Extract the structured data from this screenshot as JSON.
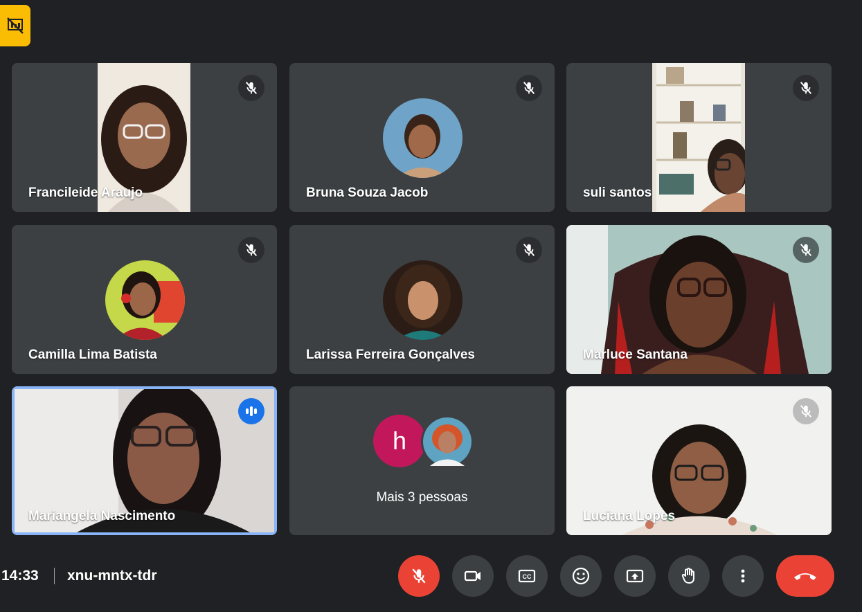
{
  "participants": [
    {
      "name": "Francileide Araujo",
      "mic": "muted",
      "view": "video"
    },
    {
      "name": "Bruna Souza Jacob",
      "mic": "muted",
      "view": "avatar"
    },
    {
      "name": "suli santos",
      "mic": "muted",
      "view": "video"
    },
    {
      "name": "Camilla Lima Batista",
      "mic": "muted",
      "view": "avatar"
    },
    {
      "name": "Larissa Ferreira Gonçalves",
      "mic": "muted",
      "view": "avatar"
    },
    {
      "name": "Marluce Santana",
      "mic": "muted",
      "view": "video"
    },
    {
      "name": "Mariangela Nascimento",
      "mic": "speaking",
      "view": "video"
    },
    {
      "name": "Luciana Lopes",
      "mic": "muted",
      "view": "video"
    }
  ],
  "overflow": {
    "initial": "h",
    "label": "Mais 3 pessoas"
  },
  "footer": {
    "time": "14:33",
    "meeting_code": "xnu-mntx-tdr"
  },
  "controls": [
    {
      "name": "mic-off-button",
      "icon": "mic-off-icon",
      "state": "off"
    },
    {
      "name": "camera-button",
      "icon": "video-camera-icon"
    },
    {
      "name": "captions-button",
      "icon": "closed-captions-icon"
    },
    {
      "name": "reactions-button",
      "icon": "emoji-icon"
    },
    {
      "name": "present-button",
      "icon": "present-screen-icon"
    },
    {
      "name": "raise-hand-button",
      "icon": "hand-icon"
    },
    {
      "name": "more-options-button",
      "icon": "more-vert-icon"
    },
    {
      "name": "leave-call-button",
      "icon": "hang-up-icon"
    }
  ],
  "colors": {
    "background": "#202124",
    "tile": "#3c4043",
    "accent": "#1a73e8",
    "danger": "#ea4335",
    "badge": "#fbbc04",
    "overflow_avatar": "#c2185b"
  }
}
